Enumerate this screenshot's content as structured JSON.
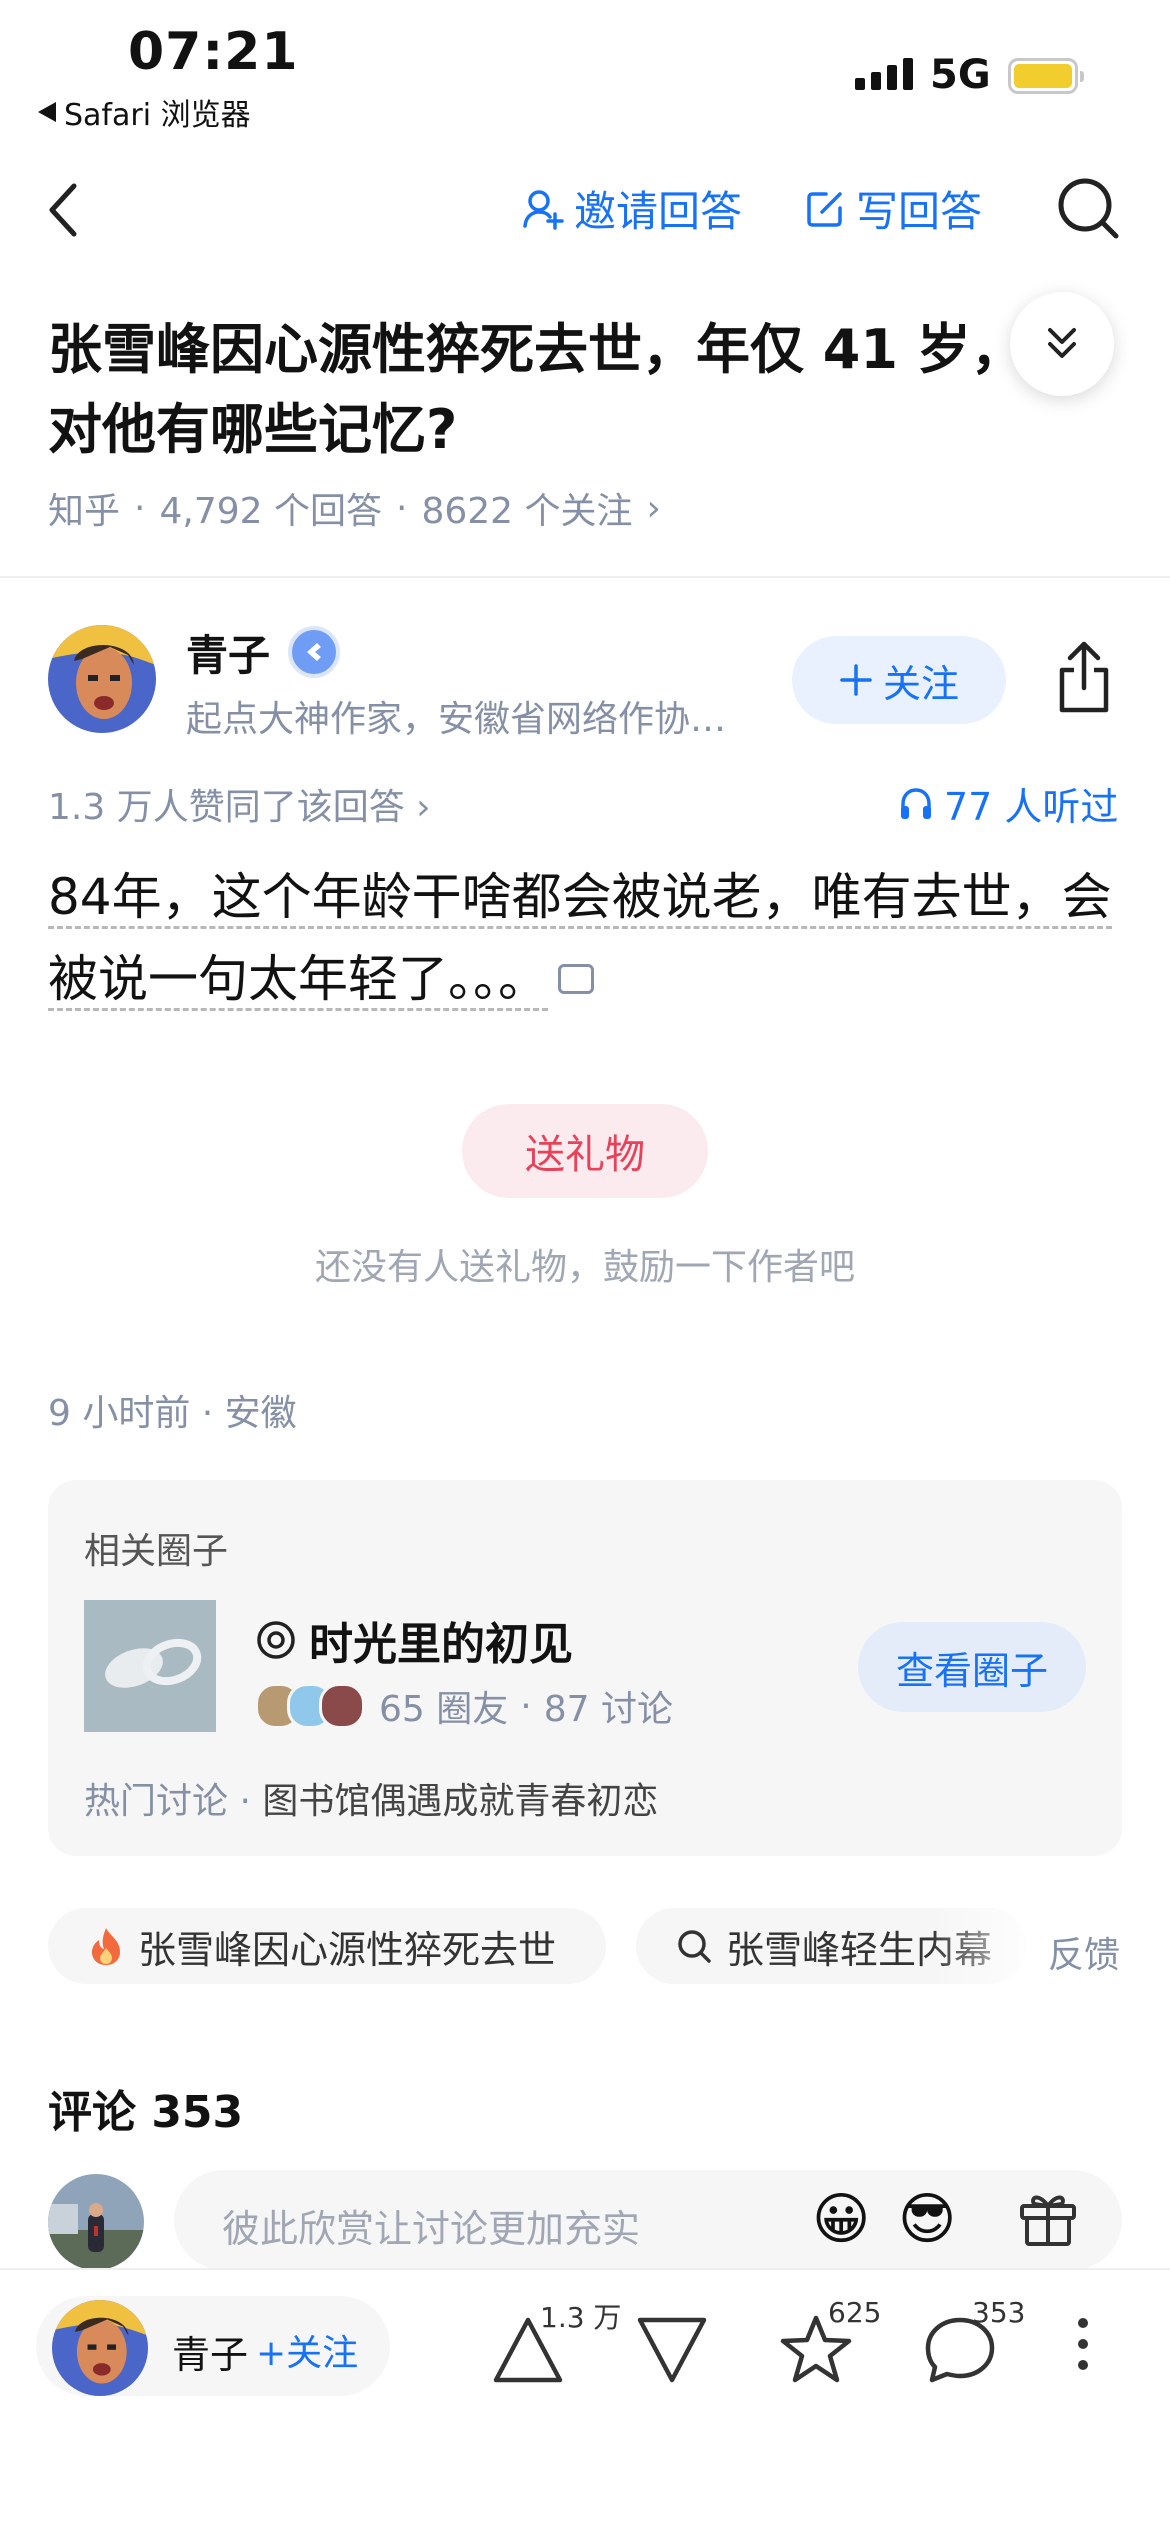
{
  "status_bar": {
    "time": "07:21",
    "back_app": "Safari 浏览器",
    "network": "5G"
  },
  "nav": {
    "invite_label": "邀请回答",
    "write_label": "写回答"
  },
  "question": {
    "title": "张雪峰因心源性猝死去世，年仅 41 岁，对他有哪些记忆?",
    "source": "知乎",
    "answers": "4,792 个回答",
    "followers": "8622 个关注",
    "sep": "·",
    "chev": "›"
  },
  "author": {
    "name": "青子",
    "desc": "起点大神作家，安徽省网络作协…",
    "follow_label": "关注",
    "upvotes": "1.3 万人赞同了该回答 ›",
    "listened": "77 人听过"
  },
  "answer": {
    "text": "84年，这个年龄干啥都会被说老，唯有去世，会被说一句太年轻了。。。"
  },
  "gift": {
    "button": "送礼物",
    "hint": "还没有人送礼物，鼓励一下作者吧"
  },
  "meta": {
    "time_location": "9 小时前 · 安徽"
  },
  "circle": {
    "heading": "相关圈子",
    "name": "时光里的初见",
    "members": "65 圈友",
    "discussions": "87 讨论",
    "sep": "·",
    "view_button": "查看圈子",
    "hot_label": "热门讨论 ·",
    "hot_topic": "图书馆偶遇成就青春初恋"
  },
  "tags": [
    {
      "label": "张雪峰因心源性猝死去世",
      "icon": "fire-icon"
    },
    {
      "label": "张雪峰轻生内幕",
      "icon": "search-icon"
    }
  ],
  "feedback": "反馈",
  "comments": {
    "title": "评论 353",
    "placeholder": "彼此欣赏让讨论更加充实",
    "emoji1": "😀",
    "emoji2": "😎"
  },
  "bottom_bar": {
    "name": "青子",
    "follow": "+关注",
    "upvote_count": "1.3 万",
    "favorite_count": "625",
    "comment_count": "353"
  },
  "colors": {
    "accent": "#1772f6",
    "gift": "#e8425a",
    "muted": "#8590a6"
  }
}
